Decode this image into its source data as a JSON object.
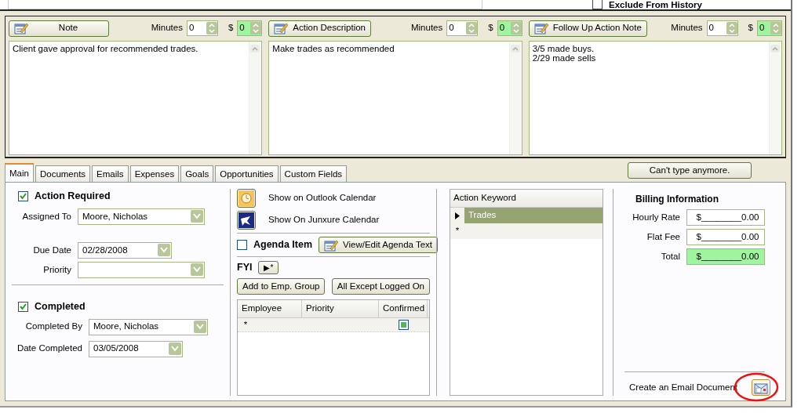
{
  "top": {
    "exclude_history": {
      "label": "Exclude From History",
      "checked": false
    }
  },
  "notes": [
    {
      "button": "Note",
      "minutes_label": "Minutes",
      "minutes": "0",
      "dollar_label": "$",
      "dollars": "0",
      "lines": [
        "Client gave approval for recommended trades."
      ]
    },
    {
      "button": "Action Description",
      "minutes_label": "Minutes",
      "minutes": "0",
      "dollar_label": "$",
      "dollars": "0",
      "lines": [
        "Make trades as recommended"
      ]
    },
    {
      "button": "Follow Up Action Note",
      "minutes_label": "Minutes",
      "minutes": "0",
      "dollar_label": "$",
      "dollars": "0",
      "lines": [
        "3/5 made buys.",
        "2/29 made sells"
      ]
    }
  ],
  "tabs": [
    {
      "label": "Main",
      "selected": true
    },
    {
      "label": "Documents",
      "selected": false
    },
    {
      "label": "Emails",
      "selected": false
    },
    {
      "label": "Expenses",
      "selected": false
    },
    {
      "label": "Goals",
      "selected": false
    },
    {
      "label": "Opportunities",
      "selected": false
    },
    {
      "label": "Custom Fields",
      "selected": false
    }
  ],
  "status_button": "Can't type anymore.",
  "action": {
    "label": "Action Required",
    "checked": true,
    "fields": [
      {
        "label": "Assigned To",
        "value": "Moore, Nicholas",
        "kind": "wide"
      },
      {
        "label": "Due Date",
        "value": "02/28/2008",
        "kind": "date"
      },
      {
        "label": "Priority",
        "kind": "wide"
      }
    ]
  },
  "completed": {
    "label": "Completed",
    "checked": true,
    "fields": [
      {
        "label": "Completed By",
        "value": "Moore, Nicholas",
        "kind": "wide"
      },
      {
        "label": "Date Completed",
        "value": "03/05/2008",
        "kind": "date"
      }
    ]
  },
  "calendar": [
    {
      "label": "Show on Outlook Calendar",
      "kind": "outlook"
    },
    {
      "label": "Show On Junxure Calendar",
      "kind": "junxure"
    }
  ],
  "agenda": {
    "label": "Agenda Item",
    "checked": false,
    "button": "View/Edit Agenda Text"
  },
  "fyi": {
    "label": "FYI",
    "button": "▶*",
    "buttons": [
      "Add to Emp. Group",
      "All Except Logged On"
    ],
    "columns": [
      "Employee",
      "Priority",
      "Confirmed"
    ],
    "new_row": {
      "marker": "*",
      "confirmed": true
    }
  },
  "keywords": {
    "column": "Action Keyword",
    "rows": [
      {
        "value": "Trades",
        "selected": true
      }
    ],
    "new_row_marker": "*"
  },
  "billing": {
    "title": "Billing Information",
    "rows": [
      {
        "label": "Hourly Rate",
        "value": "$________0.00",
        "highlighted": false
      },
      {
        "label": "Flat Fee",
        "value": "$________0.00",
        "highlighted": false
      },
      {
        "label": "Total",
        "value": "$________0.00",
        "highlighted": true
      }
    ]
  },
  "email": {
    "label": "Create an Email Document"
  }
}
